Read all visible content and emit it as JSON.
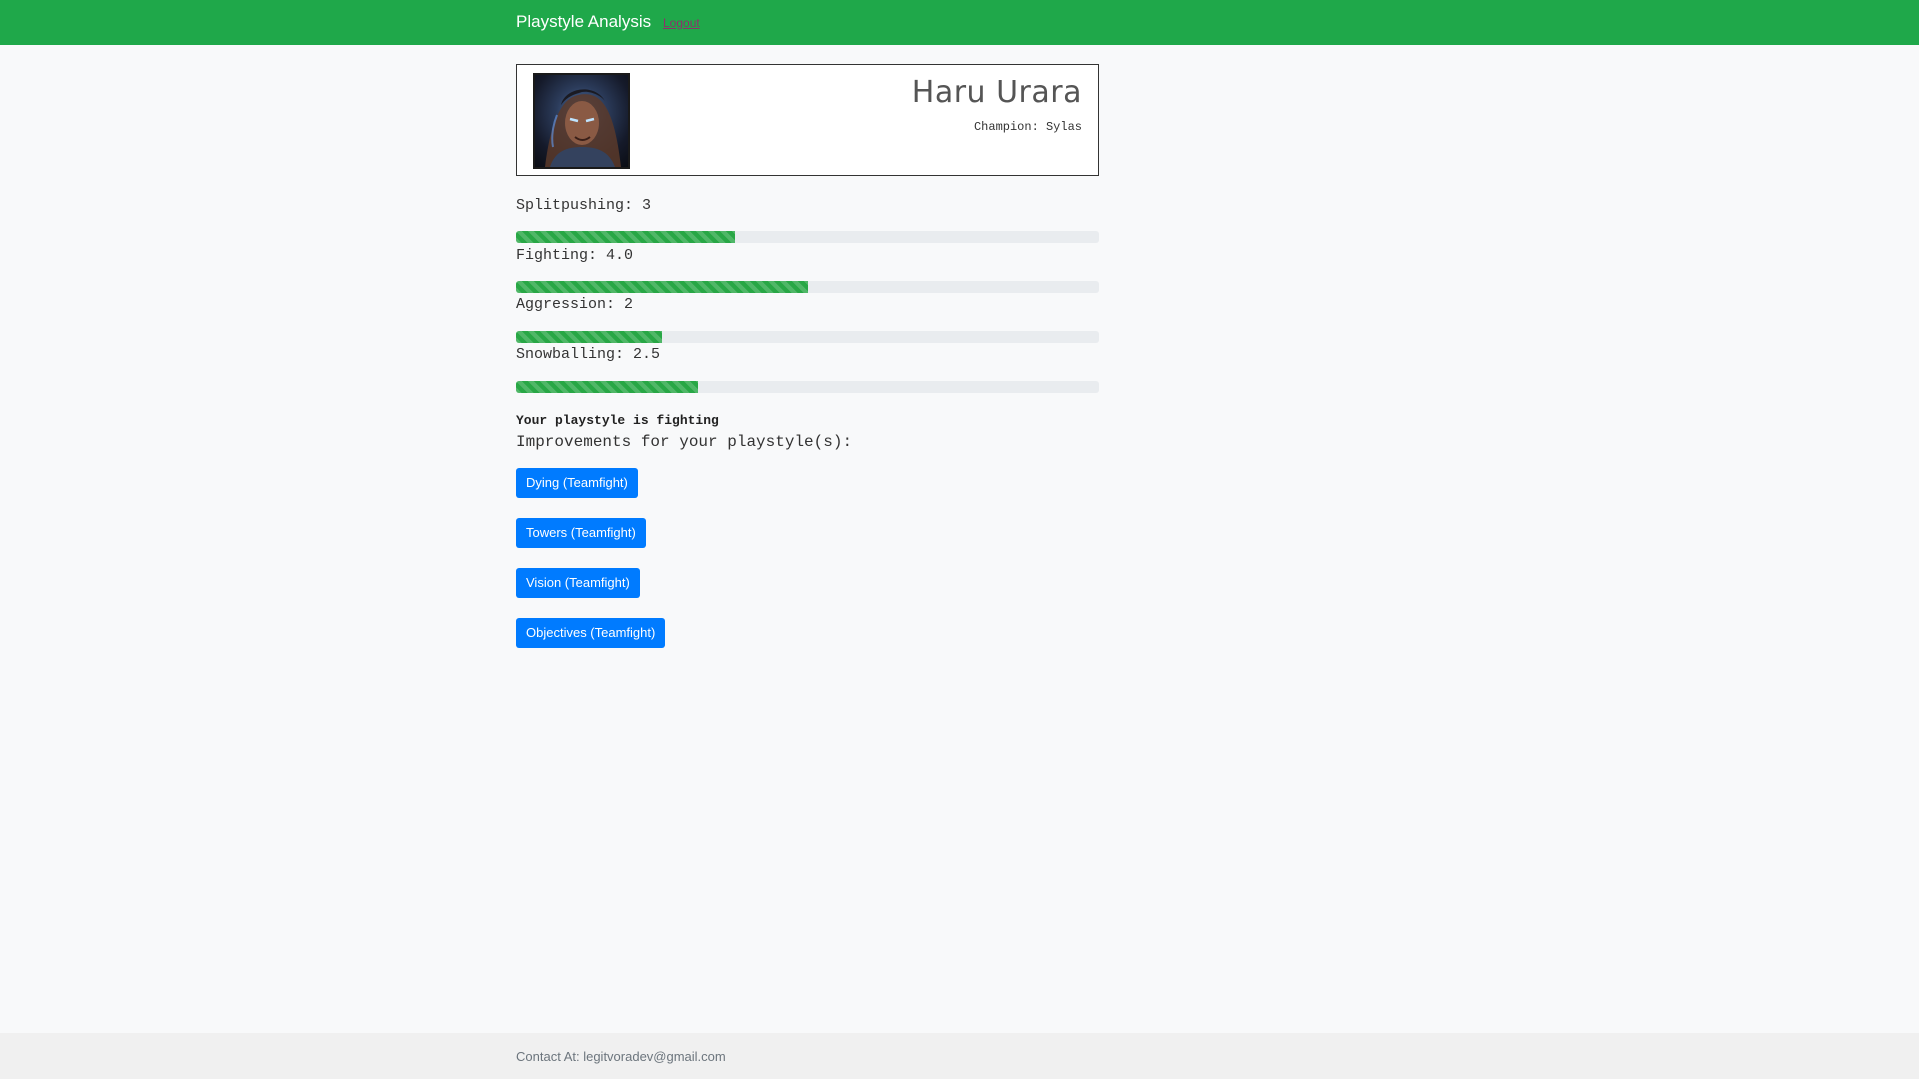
{
  "navbar": {
    "brand": "Playstyle Analysis",
    "logout": "Logout",
    "color": "#1fa84a"
  },
  "profile": {
    "summoner_name": "Haru Urara",
    "champion_line": "Champion: Sylas",
    "avatar_icon": "champion-portrait-sylas"
  },
  "stats": [
    {
      "label": "Splitpushing: 3",
      "value": 3,
      "max": 8
    },
    {
      "label": "Fighting: 4.0",
      "value": 4.0,
      "max": 8
    },
    {
      "label": "Aggression: 2",
      "value": 2,
      "max": 8
    },
    {
      "label": "Snowballing: 2.5",
      "value": 2.5,
      "max": 8
    }
  ],
  "result": {
    "playstyle_text": "Your playstyle is fighting",
    "improvements_heading": "Improvements for your playstyle(s):"
  },
  "improvements": [
    "Dying (Teamfight)",
    "Towers (Teamfight)",
    "Vision (Teamfight)",
    "Objectives (Teamfight)"
  ],
  "footer": {
    "contact": "Contact At: legitvoradev@gmail.com"
  },
  "colors": {
    "progress_fill": "#28a745",
    "progress_track": "#e9ecef",
    "button": "#007bff"
  }
}
